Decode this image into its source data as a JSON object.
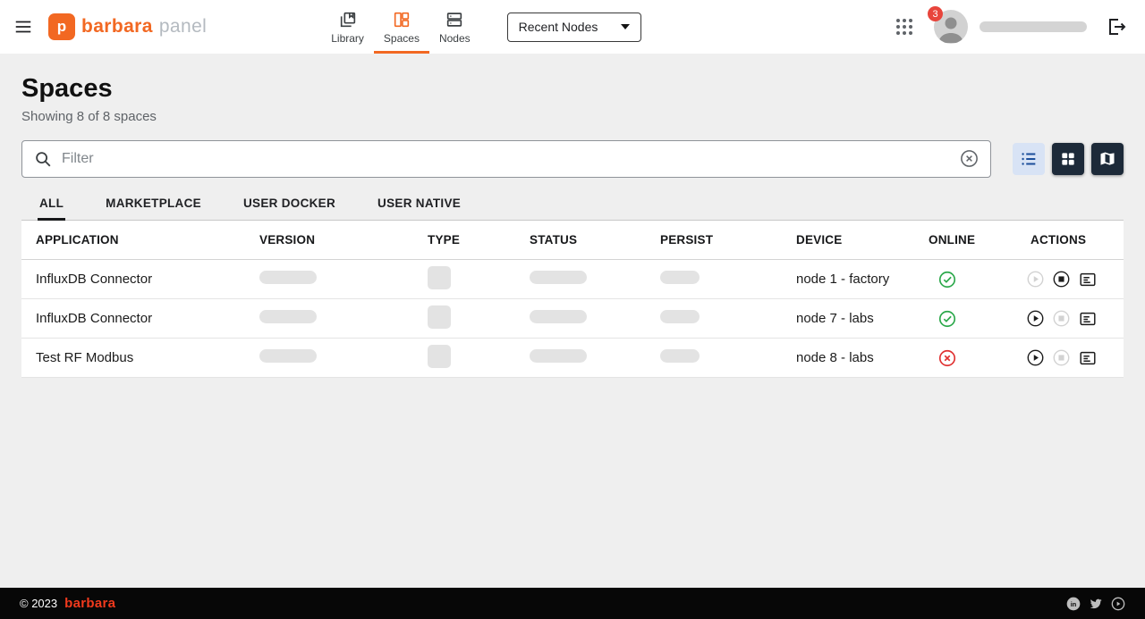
{
  "colors": {
    "accent": "#f26822",
    "footer_brand": "#f23a1d",
    "badge": "#e8453c",
    "online_green": "#2ba84a",
    "offline_red": "#e03131",
    "view_selected_bg": "#d8e3f5",
    "view_selected_fg": "#1b4e9b",
    "view_dark_bg": "#1d2a39"
  },
  "header": {
    "brand": {
      "logo_letter": "p",
      "name": "barbara",
      "suffix": "panel"
    },
    "nav_items": [
      {
        "label": "Library",
        "icon": "library-icon",
        "active": false
      },
      {
        "label": "Spaces",
        "icon": "spaces-icon",
        "active": true
      },
      {
        "label": "Nodes",
        "icon": "nodes-icon",
        "active": false
      }
    ],
    "recent_nodes_label": "Recent Nodes",
    "notification_count": "3"
  },
  "page": {
    "title": "Spaces",
    "subtitle": "Showing 8 of 8 spaces"
  },
  "filter": {
    "placeholder": "Filter",
    "value": ""
  },
  "view": {
    "selected": "list",
    "options": [
      "list",
      "grid",
      "map"
    ]
  },
  "tabs": [
    {
      "label": "ALL",
      "active": true
    },
    {
      "label": "MARKETPLACE",
      "active": false
    },
    {
      "label": "USER DOCKER",
      "active": false
    },
    {
      "label": "USER NATIVE",
      "active": false
    }
  ],
  "table": {
    "columns": [
      "APPLICATION",
      "VERSION",
      "TYPE",
      "STATUS",
      "PERSIST",
      "DEVICE",
      "ONLINE",
      "ACTIONS"
    ],
    "rows": [
      {
        "application": "InfluxDB Connector",
        "device": "node 1 - factory",
        "online": true,
        "play_enabled": false,
        "stop_enabled": true,
        "logs_enabled": true
      },
      {
        "application": "InfluxDB Connector",
        "device": "node 7 - labs",
        "online": true,
        "play_enabled": true,
        "stop_enabled": false,
        "logs_enabled": true
      },
      {
        "application": "Test RF Modbus",
        "device": "node 8 - labs",
        "online": false,
        "play_enabled": true,
        "stop_enabled": false,
        "logs_enabled": true
      }
    ]
  },
  "footer": {
    "copyright": "© 2023",
    "brand": "barbara"
  },
  "icons": [
    "hamburger-icon",
    "library-icon",
    "spaces-icon",
    "nodes-icon",
    "chevron-down-icon",
    "apps-grid-icon",
    "logout-icon",
    "search-icon",
    "clear-circle-icon",
    "list-view-icon",
    "grid-view-icon",
    "map-view-icon",
    "check-circle-icon",
    "x-circle-icon",
    "play-circle-icon",
    "stop-circle-icon",
    "logs-icon",
    "linkedin-icon",
    "twitter-icon",
    "youtube-icon"
  ]
}
